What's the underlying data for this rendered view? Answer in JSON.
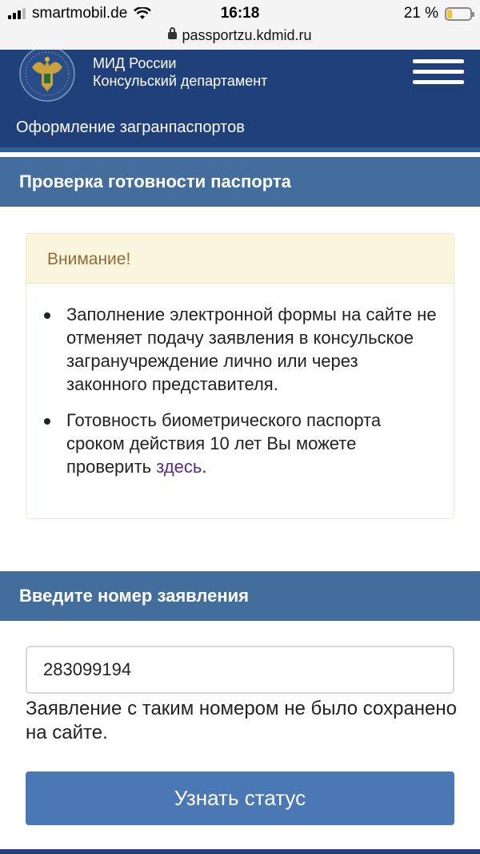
{
  "status_bar": {
    "carrier": "smartmobil.de",
    "time": "16:18",
    "battery": "21 %",
    "battery_level": 0.21
  },
  "url_bar": {
    "url": "passportzu.kdmid.ru"
  },
  "header": {
    "org_line1": "МИД России",
    "org_line2": "Консульский департамент",
    "subtitle": "Оформление загранпаспортов",
    "emblem_icon": "double-headed-eagle-emblem",
    "menu_icon": "hamburger-menu-icon"
  },
  "section_check": {
    "title": "Проверка готовности паспорта"
  },
  "alert": {
    "heading": "Внимание!",
    "item1": "Заполнение электронной формы на сайте не отменяет подачу заявления в консульское загранучреждение лично или через законного представителя.",
    "item2_prefix": "Готовность биометрического паспорта сроком действия 10 лет Вы можете проверить ",
    "item2_link": "здесь",
    "item2_suffix": "."
  },
  "section_number": {
    "title": "Введите номер заявления"
  },
  "form": {
    "input_value": "283099194",
    "message": "Заявление с таким номером не было сохранено на сайте.",
    "button_label": "Узнать статус"
  },
  "colors": {
    "header_bg": "#20407c",
    "section_bg": "#426d9c",
    "button_bg": "#4a78b4",
    "alert_head_bg": "#fbf5dd",
    "link": "#5b2c86"
  }
}
